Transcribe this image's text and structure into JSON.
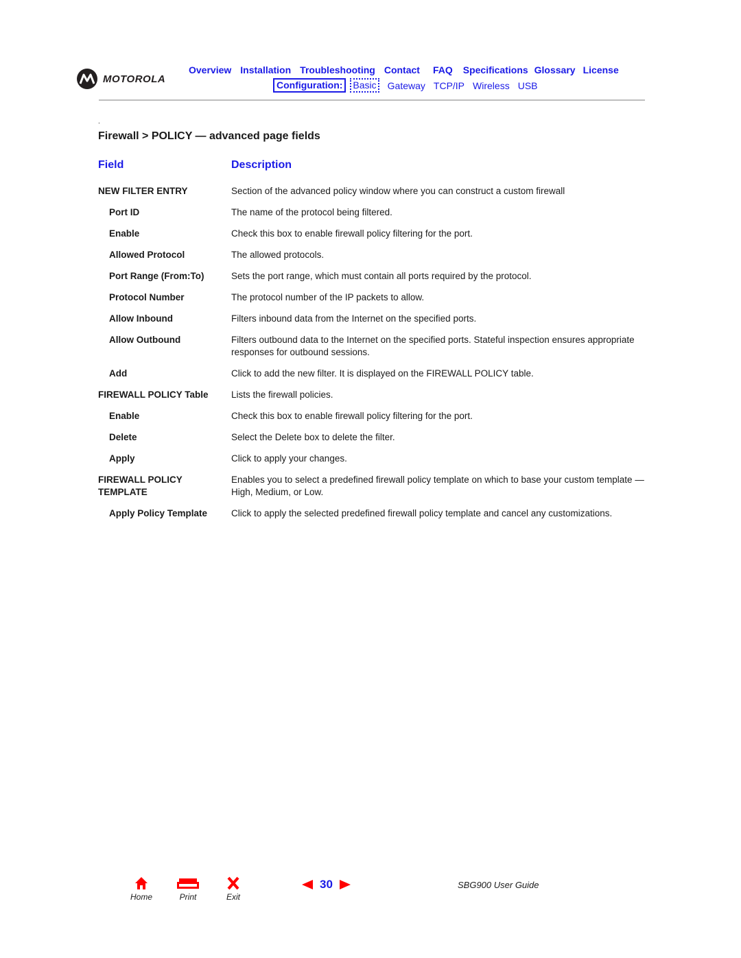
{
  "brand": {
    "name": "MOTOROLA"
  },
  "nav": {
    "primary": [
      "Overview",
      "Installation",
      "Troubleshooting",
      "Contact",
      "FAQ",
      "Specifications",
      "Glossary",
      "License"
    ],
    "config_label": "Configuration:",
    "config_active": "Basic",
    "config_items": [
      "Gateway",
      "TCP/IP",
      "Wireless",
      "USB"
    ]
  },
  "page": {
    "dot": ".",
    "title": "Firewall > POLICY — advanced page fields",
    "col_field": "Field",
    "col_description": "Description",
    "rows": [
      {
        "field": "NEW FILTER ENTRY",
        "sub": false,
        "desc": "Section of the advanced policy window where you can construct a custom firewall"
      },
      {
        "field": "Port ID",
        "sub": true,
        "desc": "The name of the protocol being filtered."
      },
      {
        "field": "Enable",
        "sub": true,
        "desc": "Check this box to enable firewall policy filtering for the port."
      },
      {
        "field": "Allowed Protocol",
        "sub": true,
        "desc": "The allowed protocols."
      },
      {
        "field": "Port Range (From:To)",
        "sub": true,
        "desc": "Sets the port range, which must contain all ports required by the protocol."
      },
      {
        "field": "Protocol Number",
        "sub": true,
        "desc": "The protocol number of the IP packets to allow."
      },
      {
        "field": "Allow Inbound",
        "sub": true,
        "desc": "Filters inbound data from the Internet on the specified ports."
      },
      {
        "field": "Allow Outbound",
        "sub": true,
        "desc": "Filters outbound data to the Internet on the specified ports. Stateful inspection ensures appropriate responses for outbound sessions."
      },
      {
        "field": "Add",
        "sub": true,
        "desc": "Click to add the new filter. It is displayed on the FIREWALL POLICY table."
      },
      {
        "field": "FIREWALL POLICY Table",
        "sub": false,
        "desc": "Lists the firewall policies."
      },
      {
        "field": "Enable",
        "sub": true,
        "desc": "Check this box to enable firewall policy filtering for the port."
      },
      {
        "field": "Delete",
        "sub": true,
        "desc": "Select the Delete box to delete the filter."
      },
      {
        "field": "Apply",
        "sub": true,
        "desc": "Click to apply your changes."
      },
      {
        "field": "FIREWALL POLICY TEMPLATE",
        "sub": false,
        "desc": "Enables you to select a predefined firewall policy template on which to base your custom template — High, Medium, or Low."
      },
      {
        "field": "Apply Policy Template",
        "sub": true,
        "desc": "Click to apply the selected predefined firewall policy template and cancel any customizations."
      }
    ]
  },
  "footer": {
    "home_label": "Home",
    "print_label": "Print",
    "exit_label": "Exit",
    "page_number": "30",
    "guide_title": "SBG900 User Guide"
  }
}
